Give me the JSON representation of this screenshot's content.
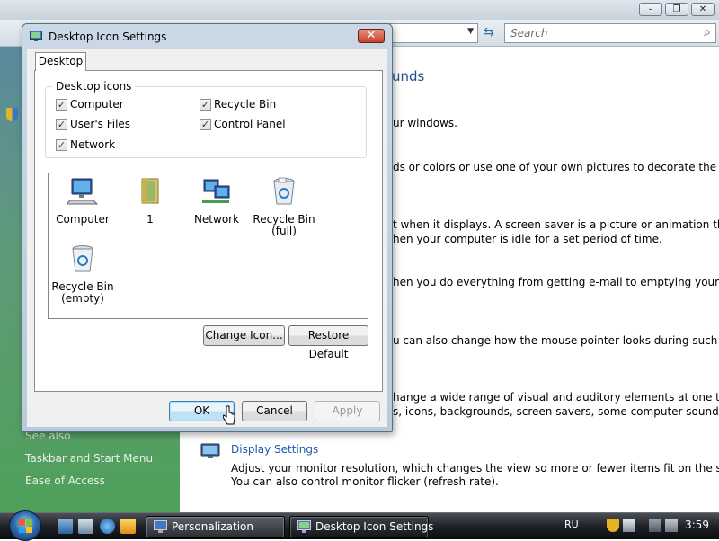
{
  "background_window": {
    "search_placeholder": "Search",
    "heading_fragment": "unds",
    "lines": [
      "ur windows.",
      "ds or colors or use one of your own pictures to decorate the",
      "t when it displays. A screen saver is a picture or animation that",
      "hen your computer is idle for a set period of time.",
      "hen you do everything from getting e-mail to emptying your",
      "u can also change how the mouse pointer looks during such",
      "hange a wide range of visual and auditory elements at one time",
      "s, icons, backgrounds, screen savers, some computer sounds, and"
    ],
    "display_settings": {
      "title": "Display Settings",
      "desc1": "Adjust your monitor resolution, which changes the view so more or fewer items fit on the screen.",
      "desc2": "You can also control monitor flicker (refresh rate)."
    },
    "left_pane": {
      "see_also": "See also",
      "links": [
        "Taskbar and Start Menu",
        "Ease of Access"
      ]
    }
  },
  "dialog": {
    "title": "Desktop Icon Settings",
    "tab": "Desktop",
    "group_label": "Desktop icons",
    "checkboxes": [
      {
        "label": "Computer",
        "checked": true
      },
      {
        "label": "Recycle Bin",
        "checked": true
      },
      {
        "label": "User's Files",
        "checked": true
      },
      {
        "label": "Control Panel",
        "checked": true
      },
      {
        "label": "Network",
        "checked": true
      }
    ],
    "icons": [
      {
        "label": "Computer",
        "icon": "computer-icon"
      },
      {
        "label": "1",
        "icon": "user-folder-icon"
      },
      {
        "label": "Network",
        "icon": "network-icon"
      },
      {
        "label": "Recycle Bin (full)",
        "label_line1": "Recycle Bin",
        "label_line2": "(full)",
        "icon": "recycle-bin-full-icon"
      },
      {
        "label": "Recycle Bin (empty)",
        "label_line1": "Recycle Bin",
        "label_line2": "(empty)",
        "icon": "recycle-bin-empty-icon"
      }
    ],
    "buttons": {
      "change_icon": "Change Icon...",
      "restore_default": "Restore Default",
      "ok": "OK",
      "cancel": "Cancel",
      "apply": "Apply"
    },
    "close_glyph": "✕"
  },
  "taskbar": {
    "tasks": [
      {
        "label": "Personalization",
        "active": false
      },
      {
        "label": "Desktop Icon Settings",
        "active": true
      }
    ],
    "language": "RU",
    "clock": "3:59"
  },
  "colors": {
    "link_blue": "#1a5bb0",
    "heading_blue": "#1e4e8c",
    "close_red": "#c2422c"
  }
}
